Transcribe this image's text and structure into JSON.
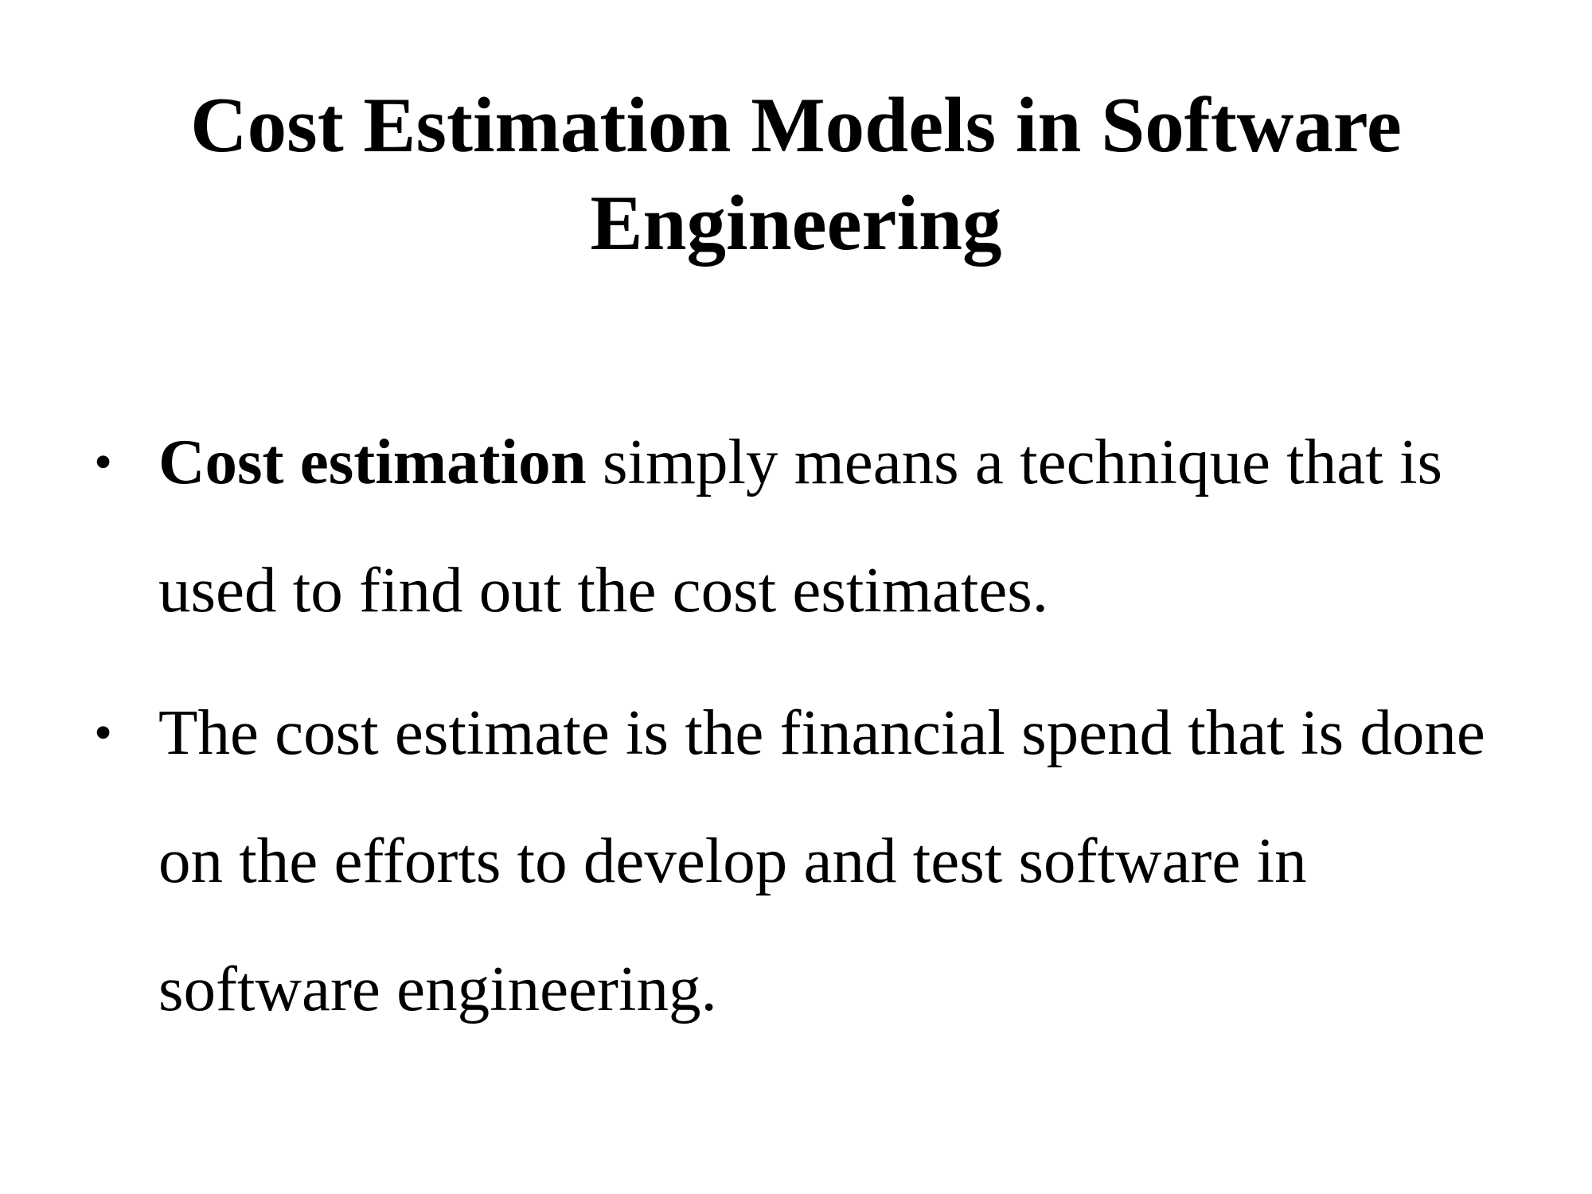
{
  "slide": {
    "title": "Cost Estimation Models in Software Engineering",
    "bullet_symbol": "•",
    "bullets": [
      {
        "bold_lead": "Cost estimation",
        "text": " simply means a technique that is used to find out the cost estimates."
      },
      {
        "bold_lead": "",
        "text": "The cost estimate is the financial spend that is done on the efforts to develop and test software in software engineering."
      }
    ]
  }
}
